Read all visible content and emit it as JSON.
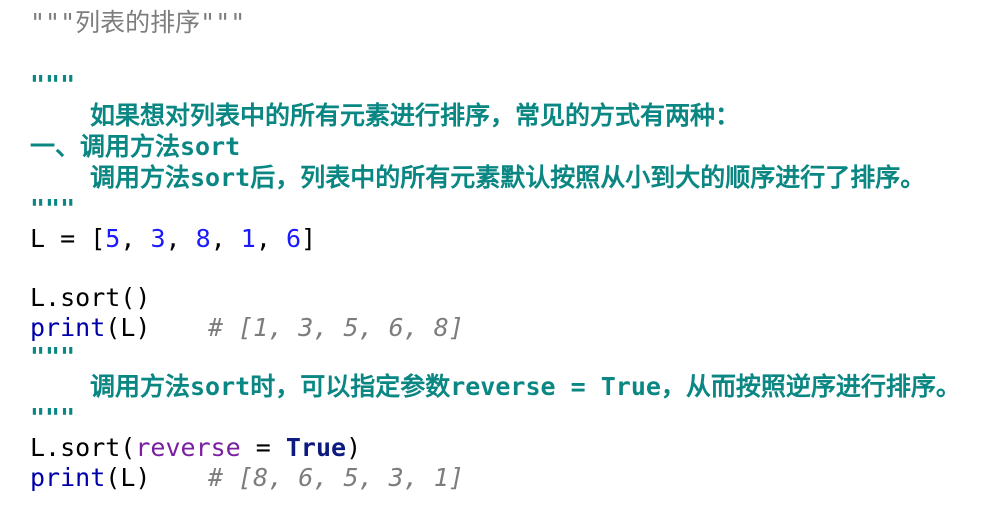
{
  "code": {
    "line1": "\"\"\"列表的排序\"\"\"",
    "doc_open_1": "\"\"\"",
    "doc_text_1": "如果想对列表中的所有元素进行排序，常见的方式有两种：",
    "doc_text_2": "一、调用方法sort",
    "doc_text_3": "调用方法sort后，列表中的所有元素默认按照从小到大的顺序进行了排序。",
    "doc_close_1": "\"\"\"",
    "assign": {
      "name": "L = [",
      "n1": "5",
      "sep1": ", ",
      "n2": "3",
      "sep2": ", ",
      "n3": "8",
      "sep3": ", ",
      "n4": "1",
      "sep4": ", ",
      "n5": "6",
      "close": "]"
    },
    "sort_call": "L.sort()",
    "print1": {
      "func": "print",
      "args": "(L)",
      "comment": "# [1, 3, 5, 6, 8]"
    },
    "doc_open_2": "\"\"\"",
    "doc_text_4": "调用方法sort时，可以指定参数reverse = True，从而按照逆序进行排序。",
    "doc_close_2": "\"\"\"",
    "sort_reverse": {
      "prefix": "L.sort(",
      "kwarg": "reverse",
      "eq": " = ",
      "value": "True",
      "suffix": ")"
    },
    "print2": {
      "func": "print",
      "args": "(L)",
      "comment": "# [8, 6, 5, 3, 1]"
    }
  }
}
